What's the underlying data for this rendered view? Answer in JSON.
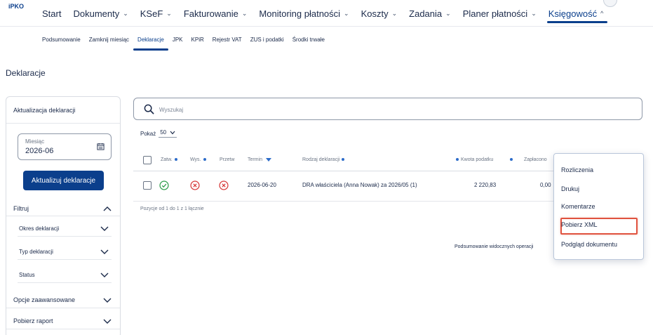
{
  "header": {
    "logo": "iPKO",
    "menu": [
      {
        "label": "Start",
        "has_dropdown": false,
        "active": false
      },
      {
        "label": "Dokumenty",
        "has_dropdown": true,
        "active": false
      },
      {
        "label": "KSeF",
        "has_dropdown": true,
        "active": false
      },
      {
        "label": "Fakturowanie",
        "has_dropdown": true,
        "active": false
      },
      {
        "label": "Monitoring płatności",
        "has_dropdown": true,
        "active": false
      },
      {
        "label": "Koszty",
        "has_dropdown": true,
        "active": false
      },
      {
        "label": "Zadania",
        "has_dropdown": true,
        "active": false
      },
      {
        "label": "Planer płatności",
        "has_dropdown": true,
        "active": false
      },
      {
        "label": "Księgowość",
        "has_dropdown": true,
        "active": true
      }
    ],
    "chevron_down": "⌄",
    "chevron_up": "^"
  },
  "subnav": {
    "items": [
      {
        "label": "Podsumowanie",
        "active": false
      },
      {
        "label": "Zamknij miesiąc",
        "active": false
      },
      {
        "label": "Deklaracje",
        "active": true
      },
      {
        "label": "JPK",
        "active": false
      },
      {
        "label": "KPiR",
        "active": false
      },
      {
        "label": "Rejestr VAT",
        "active": false
      },
      {
        "label": "ZUS i podatki",
        "active": false
      },
      {
        "label": "Środki trwałe",
        "active": false
      }
    ]
  },
  "page": {
    "title": "Deklaracje"
  },
  "sidebar": {
    "title": "Aktualizacja deklaracji",
    "month_label": "Miesiąc",
    "month_value": "2026-06",
    "update_button": "Aktualizuj deklaracje",
    "filter_title": "Filtruj",
    "filters": [
      "Okres deklaracji",
      "Typ deklaracji",
      "Status"
    ],
    "advanced_options": "Opcje zaawansowane",
    "download_report": "Pobierz raport"
  },
  "search": {
    "placeholder": "Wyszukaj",
    "value": ""
  },
  "page_size": {
    "label": "Pokaż",
    "value": "50"
  },
  "table": {
    "columns": {
      "approved": "Zatw.",
      "sent": "Wys.",
      "processed": "Przetw",
      "deadline": "Termin",
      "type": "Rodzaj deklaracji",
      "tax_amount": "Kwota podatku",
      "paid": "Zapłacono"
    },
    "rows": [
      {
        "approved": true,
        "sent": false,
        "processed": false,
        "deadline": "2026-06-20",
        "type": "DRA właściciela (Anna Nowak) za 2026/05 (1)",
        "tax_amount": "2 220,83",
        "paid": "0,00"
      }
    ],
    "pagination": "Pozycje od 1 do 1 z 1 łącznie",
    "summary": "Podsumowanie widocznych operacji"
  },
  "context_menu": {
    "items": [
      "Rozliczenia",
      "Drukuj",
      "Komentarze",
      "Pobierz XML",
      "Podgląd dokumentu"
    ],
    "highlighted": "Pobierz XML"
  },
  "colors": {
    "brand": "#0b3f8c",
    "success": "#2e9e4a",
    "error": "#d63a3a",
    "highlight": "#e0533f"
  }
}
